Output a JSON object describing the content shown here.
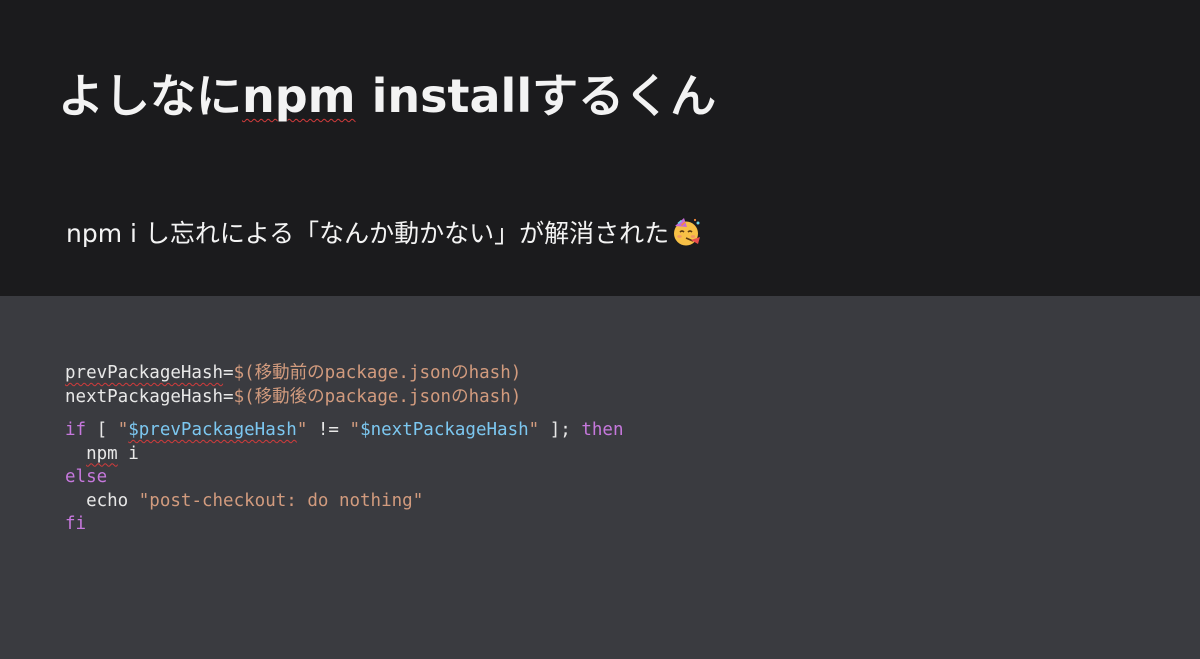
{
  "slide": {
    "title_prefix": "よしなに",
    "title_npm": "npm",
    "title_space": " ",
    "title_install": "install",
    "title_suffix": "するくん",
    "subtitle": "npm i し忘れによる「なんか動かない」が解消された",
    "emoji_icon": "partying-face-icon",
    "accent_error_underline": "#d23b3b"
  },
  "code": {
    "line1_var": "prevPackageHash",
    "line1_eq": "=",
    "line1_value": "$(移動前のpackage.jsonのhash)",
    "line2_var": "nextPackageHash",
    "line2_eq": "=",
    "line2_value": "$(移動後のpackage.jsonのhash)",
    "if_kw": "if",
    "bracket_open": " [ ",
    "quote1_open": "\"",
    "var_prev": "$prevPackageHash",
    "quote1_close": "\"",
    "neq": " != ",
    "quote2_open": "\"",
    "var_next": "$nextPackageHash",
    "quote2_close": "\"",
    "bracket_close": " ]; ",
    "then_kw": "then",
    "indent": "  ",
    "npm_cmd": "npm",
    "npm_arg": " i",
    "else_kw": "else",
    "echo_cmd": "echo ",
    "echo_str": "\"post-checkout: do nothing\"",
    "fi_kw": "fi",
    "colors": {
      "keyword": "#c678dd",
      "string": "#d29b7e",
      "variable": "#7cc7f0",
      "text": "#e8e8e8"
    }
  }
}
